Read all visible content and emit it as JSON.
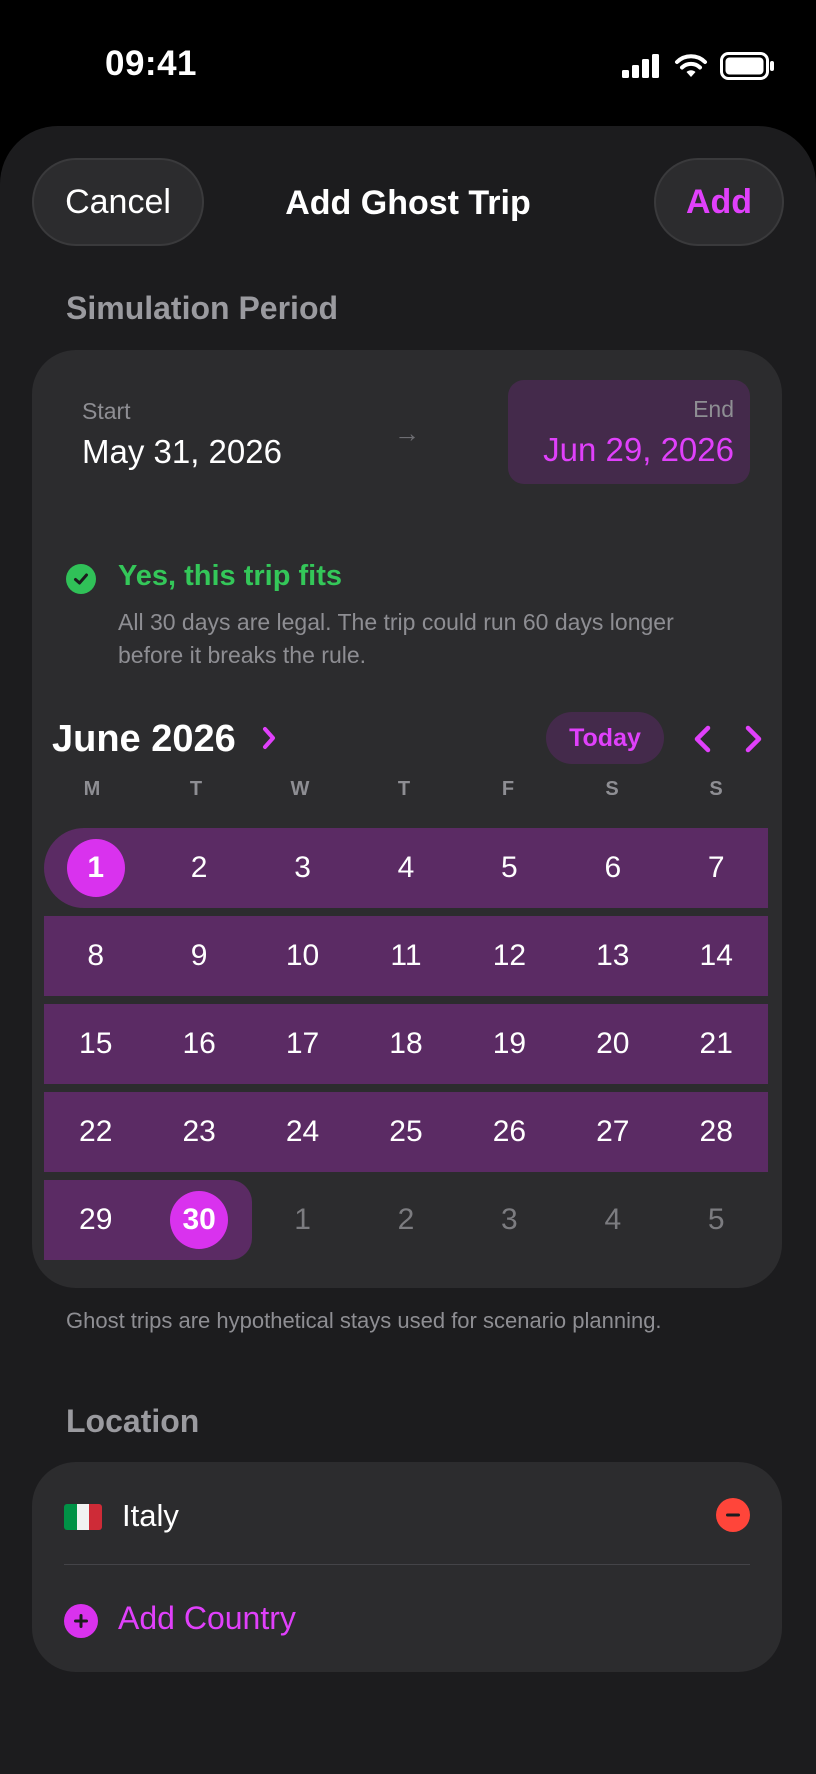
{
  "status_bar": {
    "time": "09:41"
  },
  "nav": {
    "cancel_label": "Cancel",
    "title": "Add Ghost Trip",
    "add_label": "Add"
  },
  "simulation": {
    "section_title": "Simulation Period",
    "start_label": "Start",
    "start_value": "May 31, 2026",
    "end_label": "End",
    "end_value": "Jun 29, 2026",
    "arrow": "→"
  },
  "fit": {
    "title": "Yes, this trip fits",
    "description": "All 30 days are legal. The trip could run 60 days longer before it breaks the rule."
  },
  "calendar": {
    "month_title": "June 2026",
    "today_label": "Today",
    "weekdays": [
      "M",
      "T",
      "W",
      "T",
      "F",
      "S",
      "S"
    ],
    "weeks": [
      [
        "1",
        "2",
        "3",
        "4",
        "5",
        "6",
        "7"
      ],
      [
        "8",
        "9",
        "10",
        "11",
        "12",
        "13",
        "14"
      ],
      [
        "15",
        "16",
        "17",
        "18",
        "19",
        "20",
        "21"
      ],
      [
        "22",
        "23",
        "24",
        "25",
        "26",
        "27",
        "28"
      ],
      [
        "29",
        "30",
        "1",
        "2",
        "3",
        "4",
        "5"
      ]
    ]
  },
  "footnote": "Ghost trips are hypothetical stays used for scenario planning.",
  "location": {
    "section_title": "Location",
    "country": "Italy",
    "add_country_label": "Add Country"
  },
  "colors": {
    "accent": "#e040fb",
    "success": "#34c759",
    "danger": "#ff453a",
    "range": "#5b2b64"
  }
}
